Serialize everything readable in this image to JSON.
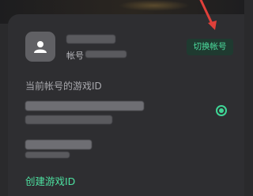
{
  "account": {
    "sub_label": "帐号",
    "switch_button": "切换帐号"
  },
  "game_ids": {
    "section_title": "当前帐号的游戏ID",
    "selected_index": 0
  },
  "create_link": "创建游戏ID",
  "colors": {
    "accent_green": "#3fd696",
    "annotation_arrow": "#e0403a"
  },
  "icons": {
    "avatar": "user-silhouette-icon",
    "annotation": "red-arrow-annotation"
  }
}
